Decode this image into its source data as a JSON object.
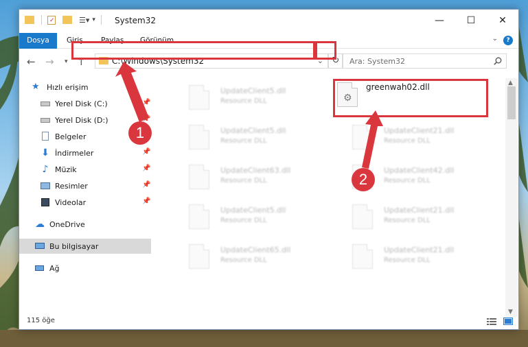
{
  "window": {
    "title": "System32",
    "controls": {
      "minimize": "—",
      "maximize": "☐",
      "close": "✕"
    }
  },
  "ribbon": {
    "tabs": [
      {
        "label": "Dosya",
        "active": true
      },
      {
        "label": "Giriş",
        "active": false
      },
      {
        "label": "Paylaş",
        "active": false
      },
      {
        "label": "Görünüm",
        "active": false
      }
    ],
    "help": "?"
  },
  "navigation": {
    "address": "C:\\Windows\\System32",
    "search_placeholder": "Ara: System32"
  },
  "sidebar": {
    "items": [
      {
        "label": "Hızlı erişim",
        "icon": "star-icon",
        "pinned": false
      },
      {
        "label": "Yerel Disk (C:)",
        "icon": "disk-icon",
        "pinned": true
      },
      {
        "label": "Yerel Disk (D:)",
        "icon": "disk-icon",
        "pinned": true
      },
      {
        "label": "Belgeler",
        "icon": "document-icon",
        "pinned": true
      },
      {
        "label": "İndirmeler",
        "icon": "download-icon",
        "pinned": true
      },
      {
        "label": "Müzik",
        "icon": "music-icon",
        "pinned": true
      },
      {
        "label": "Resimler",
        "icon": "picture-icon",
        "pinned": true
      },
      {
        "label": "Videolar",
        "icon": "video-icon",
        "pinned": true
      },
      {
        "label": "OneDrive",
        "icon": "cloud-icon",
        "pinned": false
      },
      {
        "label": "Bu bilgisayar",
        "icon": "computer-icon",
        "pinned": false,
        "selected": true
      },
      {
        "label": "Ağ",
        "icon": "network-icon",
        "pinned": false
      }
    ]
  },
  "files": [
    {
      "name": "UpdateClient5.dll",
      "type": "Resource DLL"
    },
    {
      "name": "greenwah02.dll",
      "type": ""
    },
    {
      "name": "UpdateClient5.dll",
      "type": "Resource DLL"
    },
    {
      "name": "UpdateClient21.dll",
      "type": "Resource DLL"
    },
    {
      "name": "UpdateClient63.dll",
      "type": "Resource DLL"
    },
    {
      "name": "UpdateClient42.dll",
      "type": "Resource DLL"
    },
    {
      "name": "UpdateClient5.dll",
      "type": "Resource DLL"
    },
    {
      "name": "UpdateClient21.dll",
      "type": "Resource DLL"
    },
    {
      "name": "UpdateClient65.dll",
      "type": "Resource DLL"
    },
    {
      "name": "UpdateClient21.dll",
      "type": "Resource DLL"
    }
  ],
  "status": {
    "count": "115 öğe"
  },
  "annotations": {
    "step1": "1",
    "step2": "2",
    "color": "#d9373d"
  }
}
